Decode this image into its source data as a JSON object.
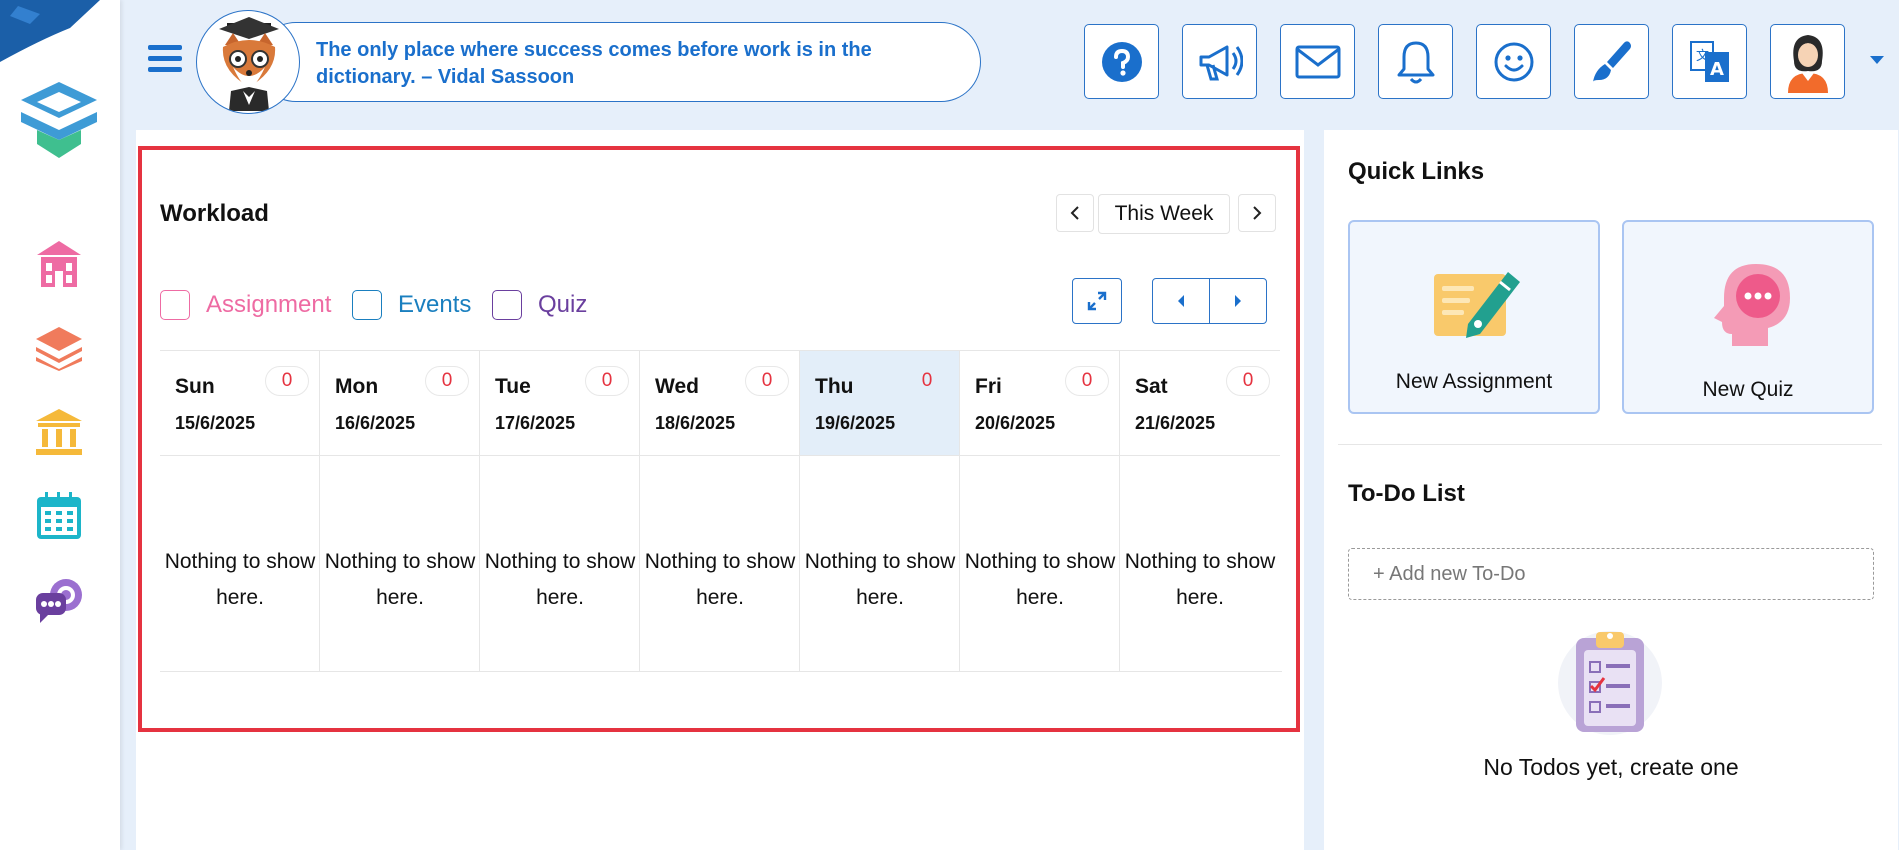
{
  "header": {
    "quote": "The only place where success comes before work is in the dictionary. – Vidal Sassoon",
    "buttons": [
      {
        "icon": "help-icon"
      },
      {
        "icon": "megaphone-icon"
      },
      {
        "icon": "mail-icon"
      },
      {
        "icon": "bell-icon"
      },
      {
        "icon": "smiley-icon"
      },
      {
        "icon": "paintbrush-icon"
      },
      {
        "icon": "translate-icon"
      },
      {
        "icon": "avatar"
      }
    ]
  },
  "sidebar": {
    "items": [
      {
        "icon": "school-icon",
        "color": "#ee6ba3"
      },
      {
        "icon": "layers-icon",
        "color": "#f07b5c"
      },
      {
        "icon": "institution-icon",
        "color": "#f5b93a"
      },
      {
        "icon": "calendar-icon",
        "color": "#1cb5c9"
      },
      {
        "icon": "chat-icon",
        "color": "#7b4bb3"
      }
    ]
  },
  "workload": {
    "title": "Workload",
    "period": "This Week",
    "filters": [
      {
        "label": "Assignment",
        "color": "#ee6ba3"
      },
      {
        "label": "Events",
        "color": "#1a7fbf"
      },
      {
        "label": "Quiz",
        "color": "#6a3f9e"
      }
    ],
    "days": [
      {
        "name": "Sun",
        "date": "15/6/2025",
        "count": "0",
        "empty": "Nothing to show here.",
        "today": false
      },
      {
        "name": "Mon",
        "date": "16/6/2025",
        "count": "0",
        "empty": "Nothing to show here.",
        "today": false
      },
      {
        "name": "Tue",
        "date": "17/6/2025",
        "count": "0",
        "empty": "Nothing to show here.",
        "today": false
      },
      {
        "name": "Wed",
        "date": "18/6/2025",
        "count": "0",
        "empty": "Nothing to show here.",
        "today": false
      },
      {
        "name": "Thu",
        "date": "19/6/2025",
        "count": "0",
        "empty": "Nothing to show here.",
        "today": true
      },
      {
        "name": "Fri",
        "date": "20/6/2025",
        "count": "0",
        "empty": "Nothing to show here.",
        "today": false
      },
      {
        "name": "Sat",
        "date": "21/6/2025",
        "count": "0",
        "empty": "Nothing to show here.",
        "today": false
      }
    ]
  },
  "quick_links": {
    "title": "Quick Links",
    "items": [
      {
        "label": "New Assignment",
        "icon": "assignment-pen-icon"
      },
      {
        "label": "New Quiz",
        "icon": "quiz-head-icon"
      }
    ]
  },
  "todo": {
    "title": "To-Do List",
    "placeholder": "+ Add new To-Do",
    "empty": "No Todos yet, create one"
  },
  "colors": {
    "accent": "#1a6fcc",
    "highlight_border": "#e53340",
    "count": "#e53340",
    "today_bg": "#e3eef9"
  }
}
